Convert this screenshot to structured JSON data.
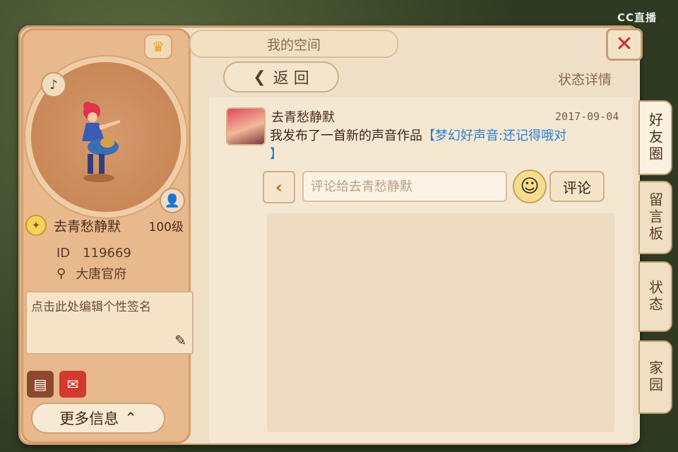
{
  "watermark": "CC直播",
  "window": {
    "title": "我的空间",
    "close_label": "✕"
  },
  "toolbar": {
    "back_label": "返 回",
    "back_icon": "chevron-left-icon",
    "section_title": "状态详情"
  },
  "profile": {
    "name": "去青愁静默",
    "level": "100级",
    "id_label": "ID",
    "id_value": "119669",
    "location": "大唐官府",
    "signature_placeholder": "点击此处编辑个性签名",
    "more_info_label": "更多信息",
    "icons": [
      "crown-icon",
      "music-disc-icon",
      "user-icon",
      "level-badge-icon",
      "location-pin-icon",
      "pen-icon",
      "treasure-chest-icon",
      "red-envelope-icon",
      "chevron-up-icon"
    ]
  },
  "post": {
    "user": "去青愁静默",
    "date": "2017-09-04",
    "text_prefix": "我发布了一首新的声音作品",
    "text_link": "【梦幻好声音:还记得哦对",
    "text_suffix": "】"
  },
  "comment": {
    "placeholder": "评论给去青愁静默",
    "submit_label": "评论"
  },
  "side_tabs": [
    "好友圈",
    "留言板",
    "状态",
    "家园"
  ],
  "active_tab": "好友圈"
}
